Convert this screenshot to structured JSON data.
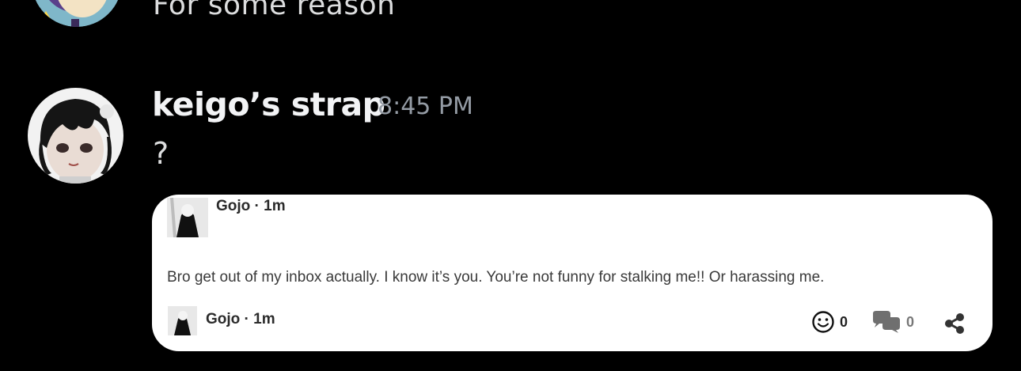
{
  "previous_message": {
    "text": "For some reason"
  },
  "message": {
    "username": "keigo’s strap",
    "timestamp": "8:45 PM",
    "content": "?"
  },
  "embed": {
    "author_top": "Gojo · 1m",
    "body": "Bro get out of my inbox actually. I know it’s you. You’re not funny for stalking me!! Or harassing me.",
    "author_footer": "Gojo · 1m",
    "reactions_count": "0",
    "comments_count": "0"
  },
  "icons": [
    "smiley-icon",
    "comments-icon",
    "share-icon"
  ]
}
